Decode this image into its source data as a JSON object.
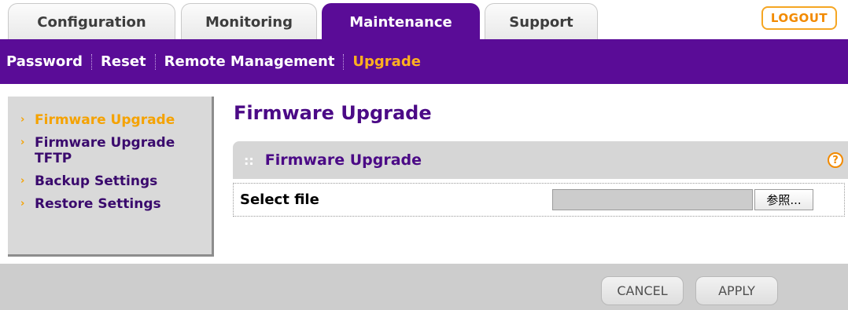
{
  "tabs": {
    "configuration": "Configuration",
    "monitoring": "Monitoring",
    "maintenance": "Maintenance",
    "support": "Support"
  },
  "logout_label": "LOGOUT",
  "subnav": {
    "password": "Password",
    "reset": "Reset",
    "remote_management": "Remote Management",
    "upgrade": "Upgrade"
  },
  "sidebar": {
    "items": [
      {
        "label": "Firmware Upgrade",
        "active": true
      },
      {
        "label": "Firmware Upgrade TFTP",
        "active": false
      },
      {
        "label": "Backup Settings",
        "active": false
      },
      {
        "label": "Restore Settings",
        "active": false
      }
    ]
  },
  "main": {
    "page_title": "Firmware Upgrade",
    "section_title": "Firmware Upgrade",
    "help_glyph": "?",
    "select_file_label": "Select file",
    "file_value": "",
    "browse_label": "参照..."
  },
  "footer": {
    "cancel_label": "CANCEL",
    "apply_label": "APPLY"
  },
  "colors": {
    "brand_purple": "#5a0c97",
    "accent_orange": "#f5a200"
  },
  "icons": {
    "menu_arrow": "menu-arrow-icon",
    "help": "help-icon",
    "section_grip": "grip-dots-icon"
  }
}
